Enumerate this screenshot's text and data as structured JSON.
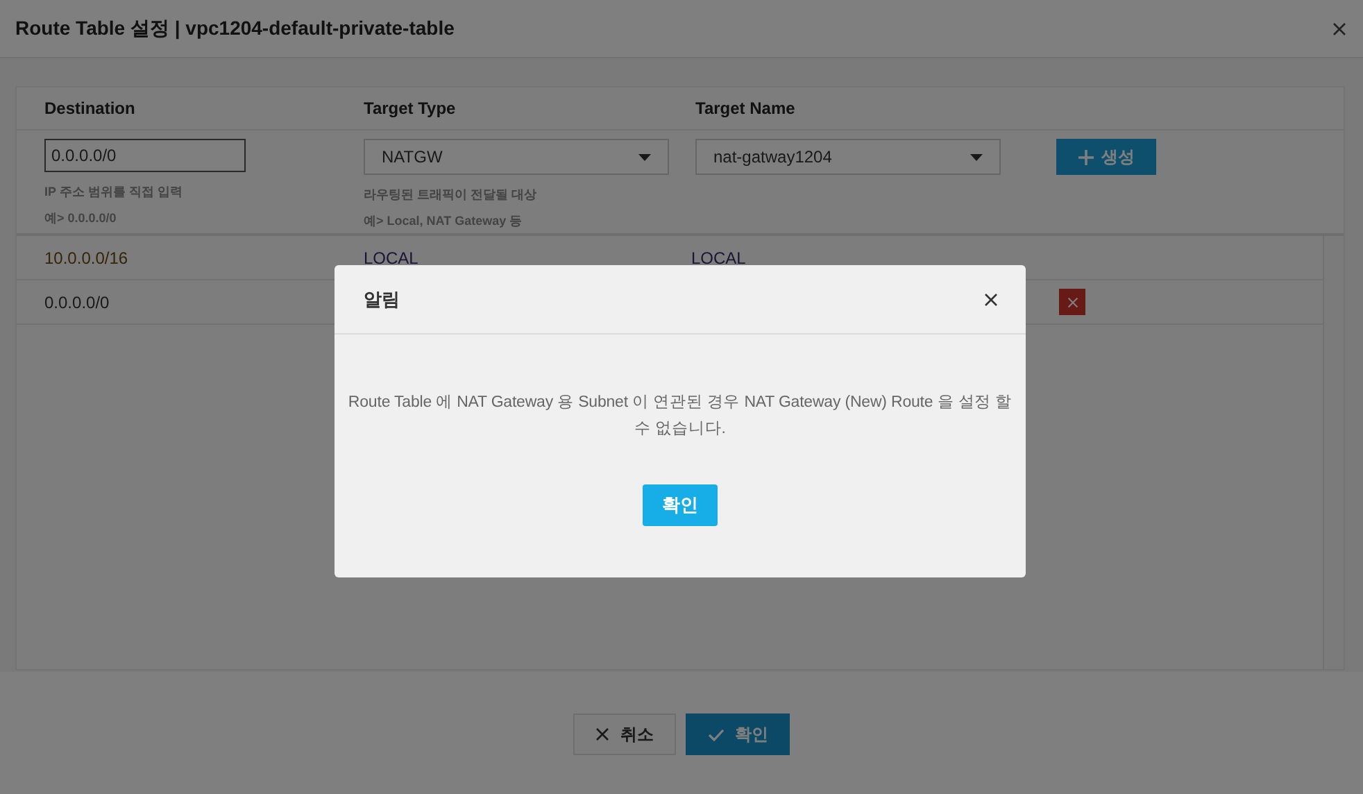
{
  "window": {
    "title": "Route Table 설정 | vpc1204-default-private-table"
  },
  "form": {
    "columns": [
      "Destination",
      "Target Type",
      "Target Name"
    ],
    "destination": {
      "value": "0.0.0.0/0",
      "hints": [
        "IP 주소 범위를 직접 입력",
        "예> 0.0.0.0/0"
      ]
    },
    "target_type": {
      "value": "NATGW",
      "hints": [
        "라우팅된 트래픽이 전달될 대상",
        "예> Local, NAT Gateway 등"
      ]
    },
    "target_name": {
      "value": "nat-gatway1204"
    },
    "add_button": "생성"
  },
  "routes": [
    {
      "destination": "10.0.0.0/16",
      "target_type": "LOCAL",
      "target_name": "LOCAL",
      "deletable": false
    },
    {
      "destination": "0.0.0.0/0",
      "deletable": true
    }
  ],
  "buttons": {
    "cancel": "취소",
    "confirm": "확인"
  },
  "alert": {
    "title": "알림",
    "message": "Route Table 에 NAT Gateway 용 Subnet 이 연관된 경우 NAT Gateway (New) Route 을 설정 할 수 없습니다.",
    "button": "확인"
  }
}
